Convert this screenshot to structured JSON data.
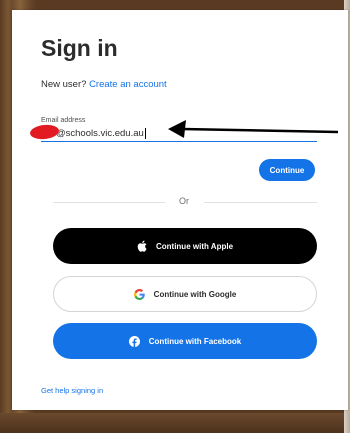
{
  "page": {
    "title": "Sign in",
    "new_user_prompt": "New user?",
    "create_account_link": "Create an account"
  },
  "email": {
    "label": "Email address",
    "value": "@schools.vic.edu.au"
  },
  "buttons": {
    "continue": "Continue",
    "divider_text": "Or",
    "apple": "Continue with Apple",
    "google": "Continue with Google",
    "facebook": "Continue with Facebook"
  },
  "help": {
    "link_text": "Get help signing in"
  },
  "colors": {
    "accent": "#1473e6",
    "apple_bg": "#000000",
    "redaction": "#e21b23",
    "annotation_arrow": "#000000"
  },
  "icons": {
    "apple": "apple-logo-icon",
    "google": "google-g-icon",
    "facebook": "facebook-f-icon",
    "annotation": "arrow-left-icon"
  }
}
